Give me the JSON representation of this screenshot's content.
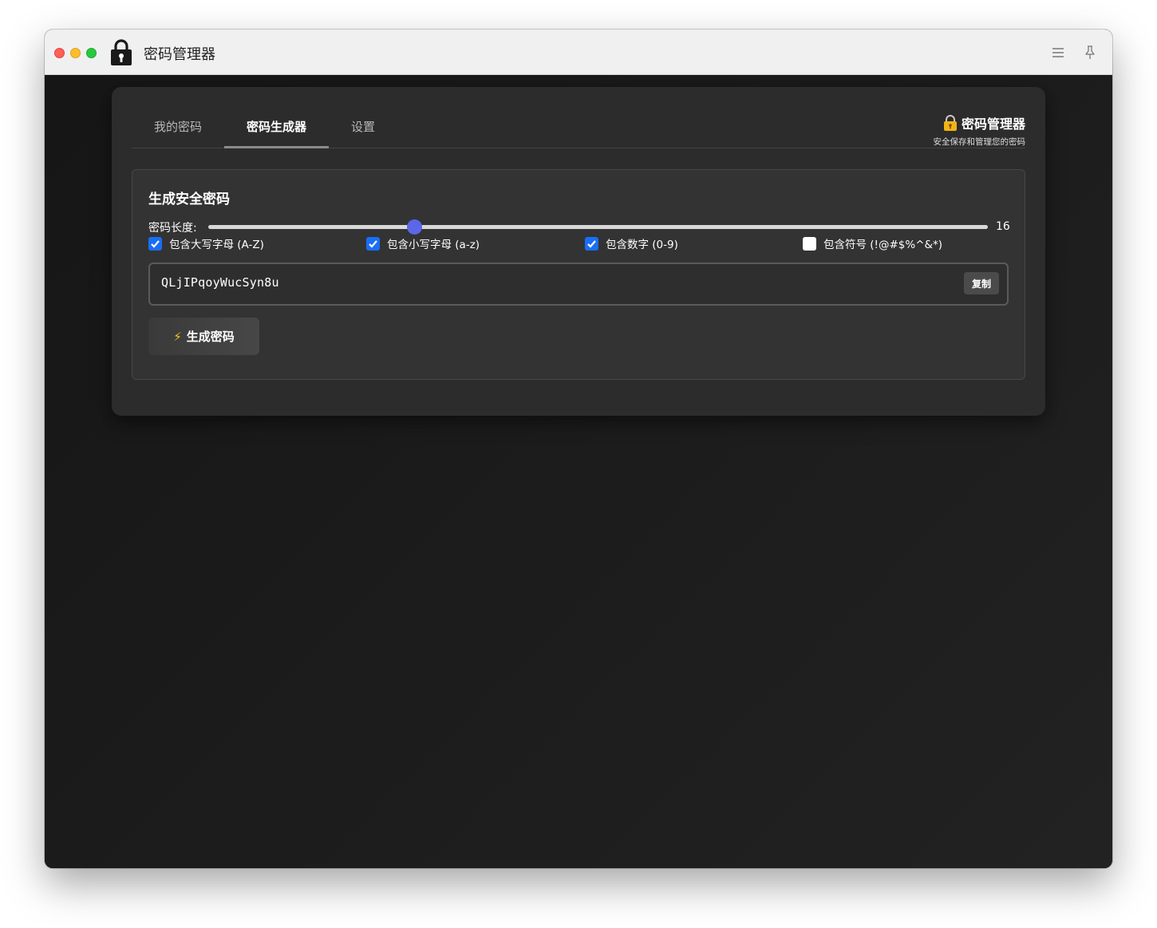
{
  "window": {
    "title": "密码管理器"
  },
  "tabs": [
    {
      "label": "我的密码",
      "active": false
    },
    {
      "label": "密码生成器",
      "active": true
    },
    {
      "label": "设置",
      "active": false
    }
  ],
  "brand": {
    "title": "密码管理器",
    "subtitle": "安全保存和管理您的密码"
  },
  "generator": {
    "heading": "生成安全密码",
    "length_label": "密码长度:",
    "length_value": "16",
    "options": [
      {
        "label": "包含大写字母 (A-Z)",
        "checked": true
      },
      {
        "label": "包含小写字母 (a-z)",
        "checked": true
      },
      {
        "label": "包含数字 (0-9)",
        "checked": true
      },
      {
        "label": "包含符号 (!@#$%^&*)",
        "checked": false
      }
    ],
    "password": "QLjIPqoyWucSyn8u",
    "copy_label": "复制",
    "generate_label": "生成密码",
    "generate_icon": "⚡"
  },
  "colors": {
    "accent": "#5b67e6",
    "checkbox": "#1a6ef5"
  }
}
